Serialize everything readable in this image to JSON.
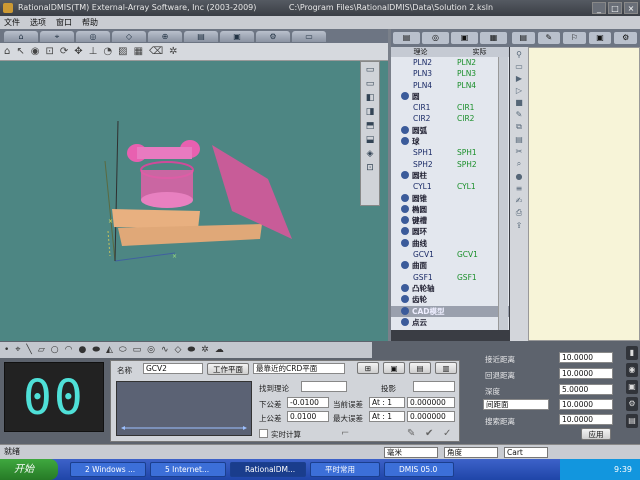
{
  "window": {
    "title": "RationalDMIS(TM) External-Array Software, Inc (2003-2009)",
    "path": "C:\\Program Files\\RationalDMIS\\Data\\Solution 2.ksln"
  },
  "menu": [
    "文件",
    "选项",
    "窗口",
    "帮助"
  ],
  "tree": {
    "col_nominal": "理论",
    "col_actual": "实际",
    "rows": [
      {
        "type": "item",
        "nom": "PLN2",
        "act": "PLN2"
      },
      {
        "type": "item",
        "nom": "PLN3",
        "act": "PLN3"
      },
      {
        "type": "item",
        "nom": "PLN4",
        "act": "PLN4"
      },
      {
        "type": "group",
        "label": "圆"
      },
      {
        "type": "item",
        "nom": "CIR1",
        "act": "CIR1"
      },
      {
        "type": "item",
        "nom": "CIR2",
        "act": "CIR2"
      },
      {
        "type": "group",
        "label": "圆弧"
      },
      {
        "type": "group",
        "label": "球"
      },
      {
        "type": "item",
        "nom": "SPH1",
        "act": "SPH1"
      },
      {
        "type": "item",
        "nom": "SPH2",
        "act": "SPH2"
      },
      {
        "type": "group",
        "label": "圆柱"
      },
      {
        "type": "item",
        "nom": "CYL1",
        "act": "CYL1"
      },
      {
        "type": "group",
        "label": "圆锥"
      },
      {
        "type": "group",
        "label": "椭圆"
      },
      {
        "type": "group",
        "label": "键槽"
      },
      {
        "type": "group",
        "label": "圆环"
      },
      {
        "type": "group",
        "label": "曲线"
      },
      {
        "type": "item",
        "nom": "GCV1",
        "act": "GCV1"
      },
      {
        "type": "group",
        "label": "曲面"
      },
      {
        "type": "item",
        "nom": "GSF1",
        "act": "GSF1"
      },
      {
        "type": "group",
        "label": "凸轮轴"
      },
      {
        "type": "group",
        "label": "齿轮"
      },
      {
        "type": "group",
        "label": "CAD模型",
        "selected": true
      },
      {
        "type": "group",
        "label": "点云"
      }
    ]
  },
  "counter": "00",
  "feature": {
    "name_label": "名称",
    "name_value": "GCV2",
    "plane_button": "工作平面",
    "plane_select": "最靠近的CRD平面",
    "find_nominal": "找到理论",
    "project": "投影",
    "lower_tol_label": "下公差",
    "lower_tol": "-0.0100",
    "upper_tol_label": "上公差",
    "upper_tol": "0.0100",
    "cur_err_label": "当前误差",
    "max_err_label": "最大误差",
    "cur_err_at": "At : 1",
    "cur_err_val": "0.000000",
    "max_err_at": "At : 1",
    "max_err_val": "0.000000",
    "realtime": "实时计算"
  },
  "params": {
    "approach_label": "接近距离",
    "approach": "10.0000",
    "retract_label": "回退距离",
    "retract": "10.0000",
    "depth_label": "深度",
    "depth": "5.0000",
    "spacing_select": "间距面",
    "spacing": "10.0000",
    "search_label": "搜索距离",
    "search": "10.0000",
    "apply": "应用"
  },
  "status": {
    "ready": "就绪",
    "unit": "毫米",
    "angle": "角度",
    "coord": "Cart"
  },
  "taskbar": {
    "start": "开始",
    "items": [
      "2 Windows ...",
      "5 Internet...",
      "RationalDM...",
      "平时常用",
      "DMIS 05.0"
    ],
    "clock": "9:39"
  }
}
